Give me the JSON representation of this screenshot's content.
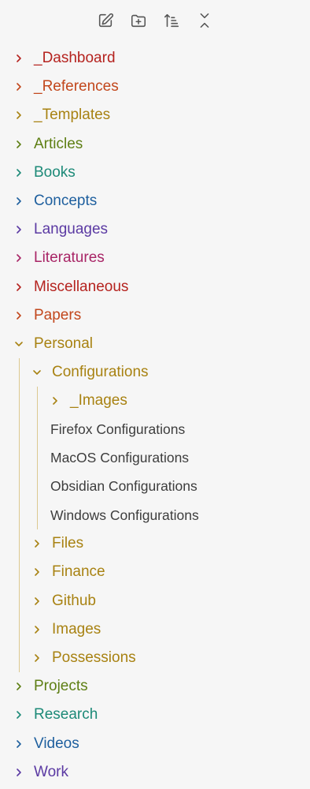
{
  "toolbar": {
    "new_note_icon": "new-note-icon",
    "new_folder_icon": "new-folder-icon",
    "sort_icon": "sort-icon",
    "collapse_icon": "collapse-all-icon"
  },
  "colors": {
    "dashboard": "#b5231f",
    "references": "#c2471c",
    "templates": "#a88212",
    "articles": "#5e7f14",
    "books": "#1d8a78",
    "concepts": "#1e5f9e",
    "languages": "#5b3aa3",
    "literatures": "#a82566",
    "miscellaneous": "#b5231f",
    "papers": "#c2471c",
    "personal": "#a88212",
    "projects": "#5e7f14",
    "research": "#1d8a78",
    "videos": "#1e5f9e",
    "work": "#5b3aa3",
    "file_text": "#3d3d3d",
    "guide_line": "#dcc890"
  },
  "tree": {
    "dashboard": "_Dashboard",
    "references": "_References",
    "templates": "_Templates",
    "articles": "Articles",
    "books": "Books",
    "concepts": "Concepts",
    "languages": "Languages",
    "literatures": "Literatures",
    "miscellaneous": "Miscellaneous",
    "papers": "Papers",
    "personal": {
      "label": "Personal",
      "configurations": {
        "label": "Configurations",
        "images": "_Images",
        "files": [
          "Firefox Configurations",
          "MacOS Configurations",
          "Obsidian Configurations",
          "Windows Configurations"
        ]
      },
      "files": "Files",
      "finance": "Finance",
      "github": "Github",
      "images": "Images",
      "possessions": "Possessions"
    },
    "projects": "Projects",
    "research": "Research",
    "videos": "Videos",
    "work": "Work"
  }
}
